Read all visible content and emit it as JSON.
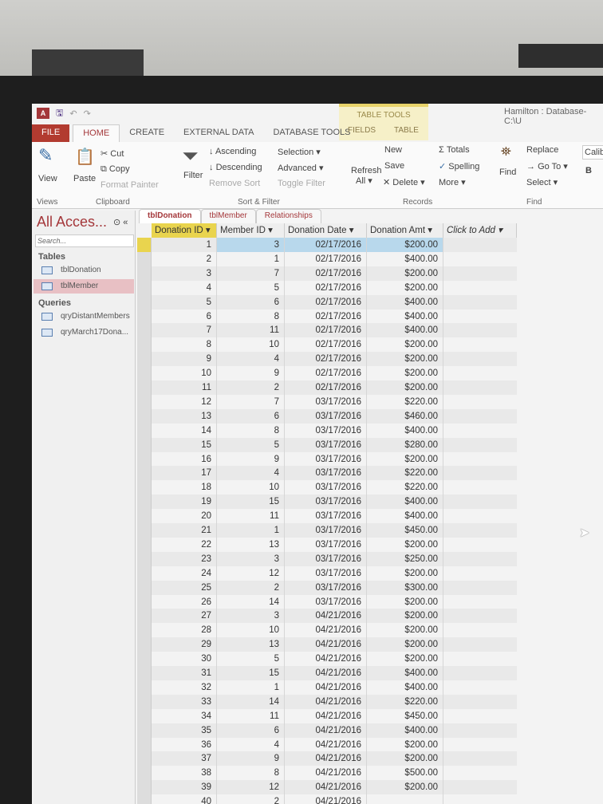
{
  "window": {
    "title": "Hamilton : Database- C:\\U",
    "context_group": "TABLE TOOLS"
  },
  "ribbon_tabs": [
    "FILE",
    "HOME",
    "CREATE",
    "EXTERNAL DATA",
    "DATABASE TOOLS"
  ],
  "context_tabs": [
    "FIELDS",
    "TABLE"
  ],
  "ribbon": {
    "views": {
      "view": "View",
      "label": "Views"
    },
    "clipboard": {
      "paste": "Paste",
      "cut": "Cut",
      "copy": "Copy",
      "format_painter": "Format Painter",
      "label": "Clipboard"
    },
    "sort_filter": {
      "filter": "Filter",
      "ascending": "Ascending",
      "descending": "Descending",
      "remove_sort": "Remove Sort",
      "selection": "Selection ▾",
      "advanced": "Advanced ▾",
      "toggle_filter": "Toggle Filter",
      "label": "Sort & Filter"
    },
    "records": {
      "refresh": "Refresh",
      "refresh_all": "All ▾",
      "new": "New",
      "save": "Save",
      "delete": "Delete ▾",
      "totals": "Totals",
      "spelling": "Spelling",
      "more": "More ▾",
      "label": "Records"
    },
    "find": {
      "find": "Find",
      "replace": "Replace",
      "goto": "Go To ▾",
      "select": "Select ▾",
      "label": "Find"
    },
    "font": {
      "name": "Calib",
      "bold": "B"
    }
  },
  "nav": {
    "title": "All Acces...",
    "search_placeholder": "Search...",
    "tables_label": "Tables",
    "queries_label": "Queries",
    "tables": [
      "tblDonation",
      "tblMember"
    ],
    "queries": [
      "qryDistantMembers",
      "qryMarch17Dona..."
    ]
  },
  "doc_tabs": [
    "tblDonation",
    "tblMember",
    "Relationships"
  ],
  "columns": [
    "Donation ID ▾",
    "Member ID ▾",
    "Donation Date ▾",
    "Donation Amt ▾",
    "Click to Add ▾"
  ],
  "rows": [
    [
      "1",
      "3",
      "02/17/2016",
      "$200.00"
    ],
    [
      "2",
      "1",
      "02/17/2016",
      "$400.00"
    ],
    [
      "3",
      "7",
      "02/17/2016",
      "$200.00"
    ],
    [
      "4",
      "5",
      "02/17/2016",
      "$200.00"
    ],
    [
      "5",
      "6",
      "02/17/2016",
      "$400.00"
    ],
    [
      "6",
      "8",
      "02/17/2016",
      "$400.00"
    ],
    [
      "7",
      "11",
      "02/17/2016",
      "$400.00"
    ],
    [
      "8",
      "10",
      "02/17/2016",
      "$200.00"
    ],
    [
      "9",
      "4",
      "02/17/2016",
      "$200.00"
    ],
    [
      "10",
      "9",
      "02/17/2016",
      "$200.00"
    ],
    [
      "11",
      "2",
      "02/17/2016",
      "$200.00"
    ],
    [
      "12",
      "7",
      "03/17/2016",
      "$220.00"
    ],
    [
      "13",
      "6",
      "03/17/2016",
      "$460.00"
    ],
    [
      "14",
      "8",
      "03/17/2016",
      "$400.00"
    ],
    [
      "15",
      "5",
      "03/17/2016",
      "$280.00"
    ],
    [
      "16",
      "9",
      "03/17/2016",
      "$200.00"
    ],
    [
      "17",
      "4",
      "03/17/2016",
      "$220.00"
    ],
    [
      "18",
      "10",
      "03/17/2016",
      "$220.00"
    ],
    [
      "19",
      "15",
      "03/17/2016",
      "$400.00"
    ],
    [
      "20",
      "11",
      "03/17/2016",
      "$400.00"
    ],
    [
      "21",
      "1",
      "03/17/2016",
      "$450.00"
    ],
    [
      "22",
      "13",
      "03/17/2016",
      "$200.00"
    ],
    [
      "23",
      "3",
      "03/17/2016",
      "$250.00"
    ],
    [
      "24",
      "12",
      "03/17/2016",
      "$200.00"
    ],
    [
      "25",
      "2",
      "03/17/2016",
      "$300.00"
    ],
    [
      "26",
      "14",
      "03/17/2016",
      "$200.00"
    ],
    [
      "27",
      "3",
      "04/21/2016",
      "$200.00"
    ],
    [
      "28",
      "10",
      "04/21/2016",
      "$200.00"
    ],
    [
      "29",
      "13",
      "04/21/2016",
      "$200.00"
    ],
    [
      "30",
      "5",
      "04/21/2016",
      "$200.00"
    ],
    [
      "31",
      "15",
      "04/21/2016",
      "$400.00"
    ],
    [
      "32",
      "1",
      "04/21/2016",
      "$400.00"
    ],
    [
      "33",
      "14",
      "04/21/2016",
      "$220.00"
    ],
    [
      "34",
      "11",
      "04/21/2016",
      "$450.00"
    ],
    [
      "35",
      "6",
      "04/21/2016",
      "$400.00"
    ],
    [
      "36",
      "4",
      "04/21/2016",
      "$200.00"
    ],
    [
      "37",
      "9",
      "04/21/2016",
      "$200.00"
    ],
    [
      "38",
      "8",
      "04/21/2016",
      "$500.00"
    ],
    [
      "39",
      "12",
      "04/21/2016",
      "$200.00"
    ],
    [
      "40",
      "2",
      "04/21/2016",
      ""
    ]
  ]
}
